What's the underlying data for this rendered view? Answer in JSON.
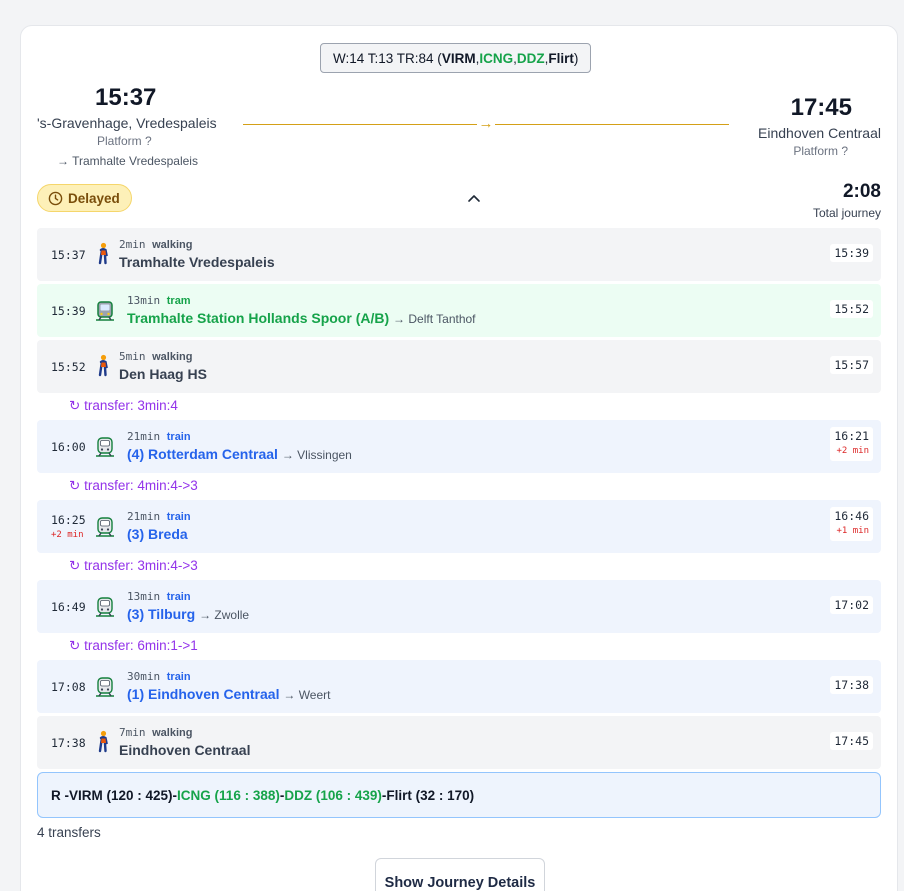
{
  "badge": {
    "prefix": "W:14 T:13 TR:84 (",
    "units": [
      {
        "name": "VIRM",
        "color": "#111827"
      },
      {
        "name": "ICNG",
        "color": "#16a34a"
      },
      {
        "name": "DDZ",
        "color": "#16a34a"
      },
      {
        "name": "Flirt",
        "color": "#111827"
      }
    ],
    "separator": ", ",
    "suffix": ")"
  },
  "departure": {
    "time": "15:37",
    "station": "'s-Gravenhage, Vredespaleis",
    "platform": "Platform ?",
    "walk_to": "→ Tramhalte Vredespaleis"
  },
  "arrival": {
    "time": "17:45",
    "station": "Eindhoven Centraal",
    "platform": "Platform ?"
  },
  "route_arrow": "→",
  "status": {
    "label": "Delayed",
    "icon": "clock-icon"
  },
  "total": {
    "time": "2:08",
    "label": "Total journey"
  },
  "legs": [
    {
      "mode_type": "walk",
      "start": "15:37",
      "end": "15:39",
      "duration": "2min",
      "mode": "walking",
      "name": "Tramhalte Vredespaleis",
      "dest": "",
      "start_delay": "",
      "end_delay": "",
      "icon": "walking-person-icon"
    },
    {
      "mode_type": "tram",
      "start": "15:39",
      "end": "15:52",
      "duration": "13min",
      "mode": "tram",
      "name": "Tramhalte Station Hollands Spoor (A/B)",
      "dest": "→ Delft Tanthof",
      "start_delay": "",
      "end_delay": "",
      "icon": "tram-icon"
    },
    {
      "mode_type": "walk",
      "start": "15:52",
      "end": "15:57",
      "duration": "5min",
      "mode": "walking",
      "name": "Den Haag HS",
      "dest": "",
      "start_delay": "",
      "end_delay": "",
      "icon": "walking-person-icon"
    },
    {
      "mode_type": "train",
      "start": "16:00",
      "end": "16:21",
      "duration": "21min",
      "mode": "train",
      "name": "(4) Rotterdam Centraal",
      "dest": "→ Vlissingen",
      "start_delay": "",
      "end_delay": "+2 min",
      "icon": "train-icon"
    },
    {
      "mode_type": "train",
      "start": "16:25",
      "end": "16:46",
      "duration": "21min",
      "mode": "train",
      "name": "(3) Breda",
      "dest": "",
      "start_delay": "+2 min",
      "end_delay": "+1 min",
      "icon": "train-icon"
    },
    {
      "mode_type": "train",
      "start": "16:49",
      "end": "17:02",
      "duration": "13min",
      "mode": "train",
      "name": "(3) Tilburg",
      "dest": "→ Zwolle",
      "start_delay": "",
      "end_delay": "",
      "icon": "train-icon"
    },
    {
      "mode_type": "train",
      "start": "17:08",
      "end": "17:38",
      "duration": "30min",
      "mode": "train",
      "name": "(1) Eindhoven Centraal",
      "dest": "→ Weert",
      "start_delay": "",
      "end_delay": "",
      "icon": "train-icon"
    },
    {
      "mode_type": "walk",
      "start": "17:38",
      "end": "17:45",
      "duration": "7min",
      "mode": "walking",
      "name": "Eindhoven Centraal",
      "dest": "",
      "start_delay": "",
      "end_delay": "",
      "icon": "walking-person-icon"
    }
  ],
  "transfers": [
    {
      "icon": "↻",
      "text": "transfer: 3min:4"
    },
    {
      "icon": "↻",
      "text": "transfer: 4min:4->3"
    },
    {
      "icon": "↻",
      "text": "transfer: 3min:4->3"
    },
    {
      "icon": "↻",
      "text": "transfer: 6min:1->1"
    }
  ],
  "summary": {
    "prefix": "R - ",
    "parts": [
      {
        "text": "VIRM (120 : 425)",
        "color": "#111827"
      },
      {
        "text": "ICNG (116 : 388)",
        "color": "#16a34a"
      },
      {
        "text": "DDZ (106 : 439)",
        "color": "#16a34a"
      },
      {
        "text": "Flirt (32 : 170)",
        "color": "#111827"
      }
    ],
    "separator": " - "
  },
  "transfers_count": "4 transfers",
  "details_button": "Show Journey Details"
}
